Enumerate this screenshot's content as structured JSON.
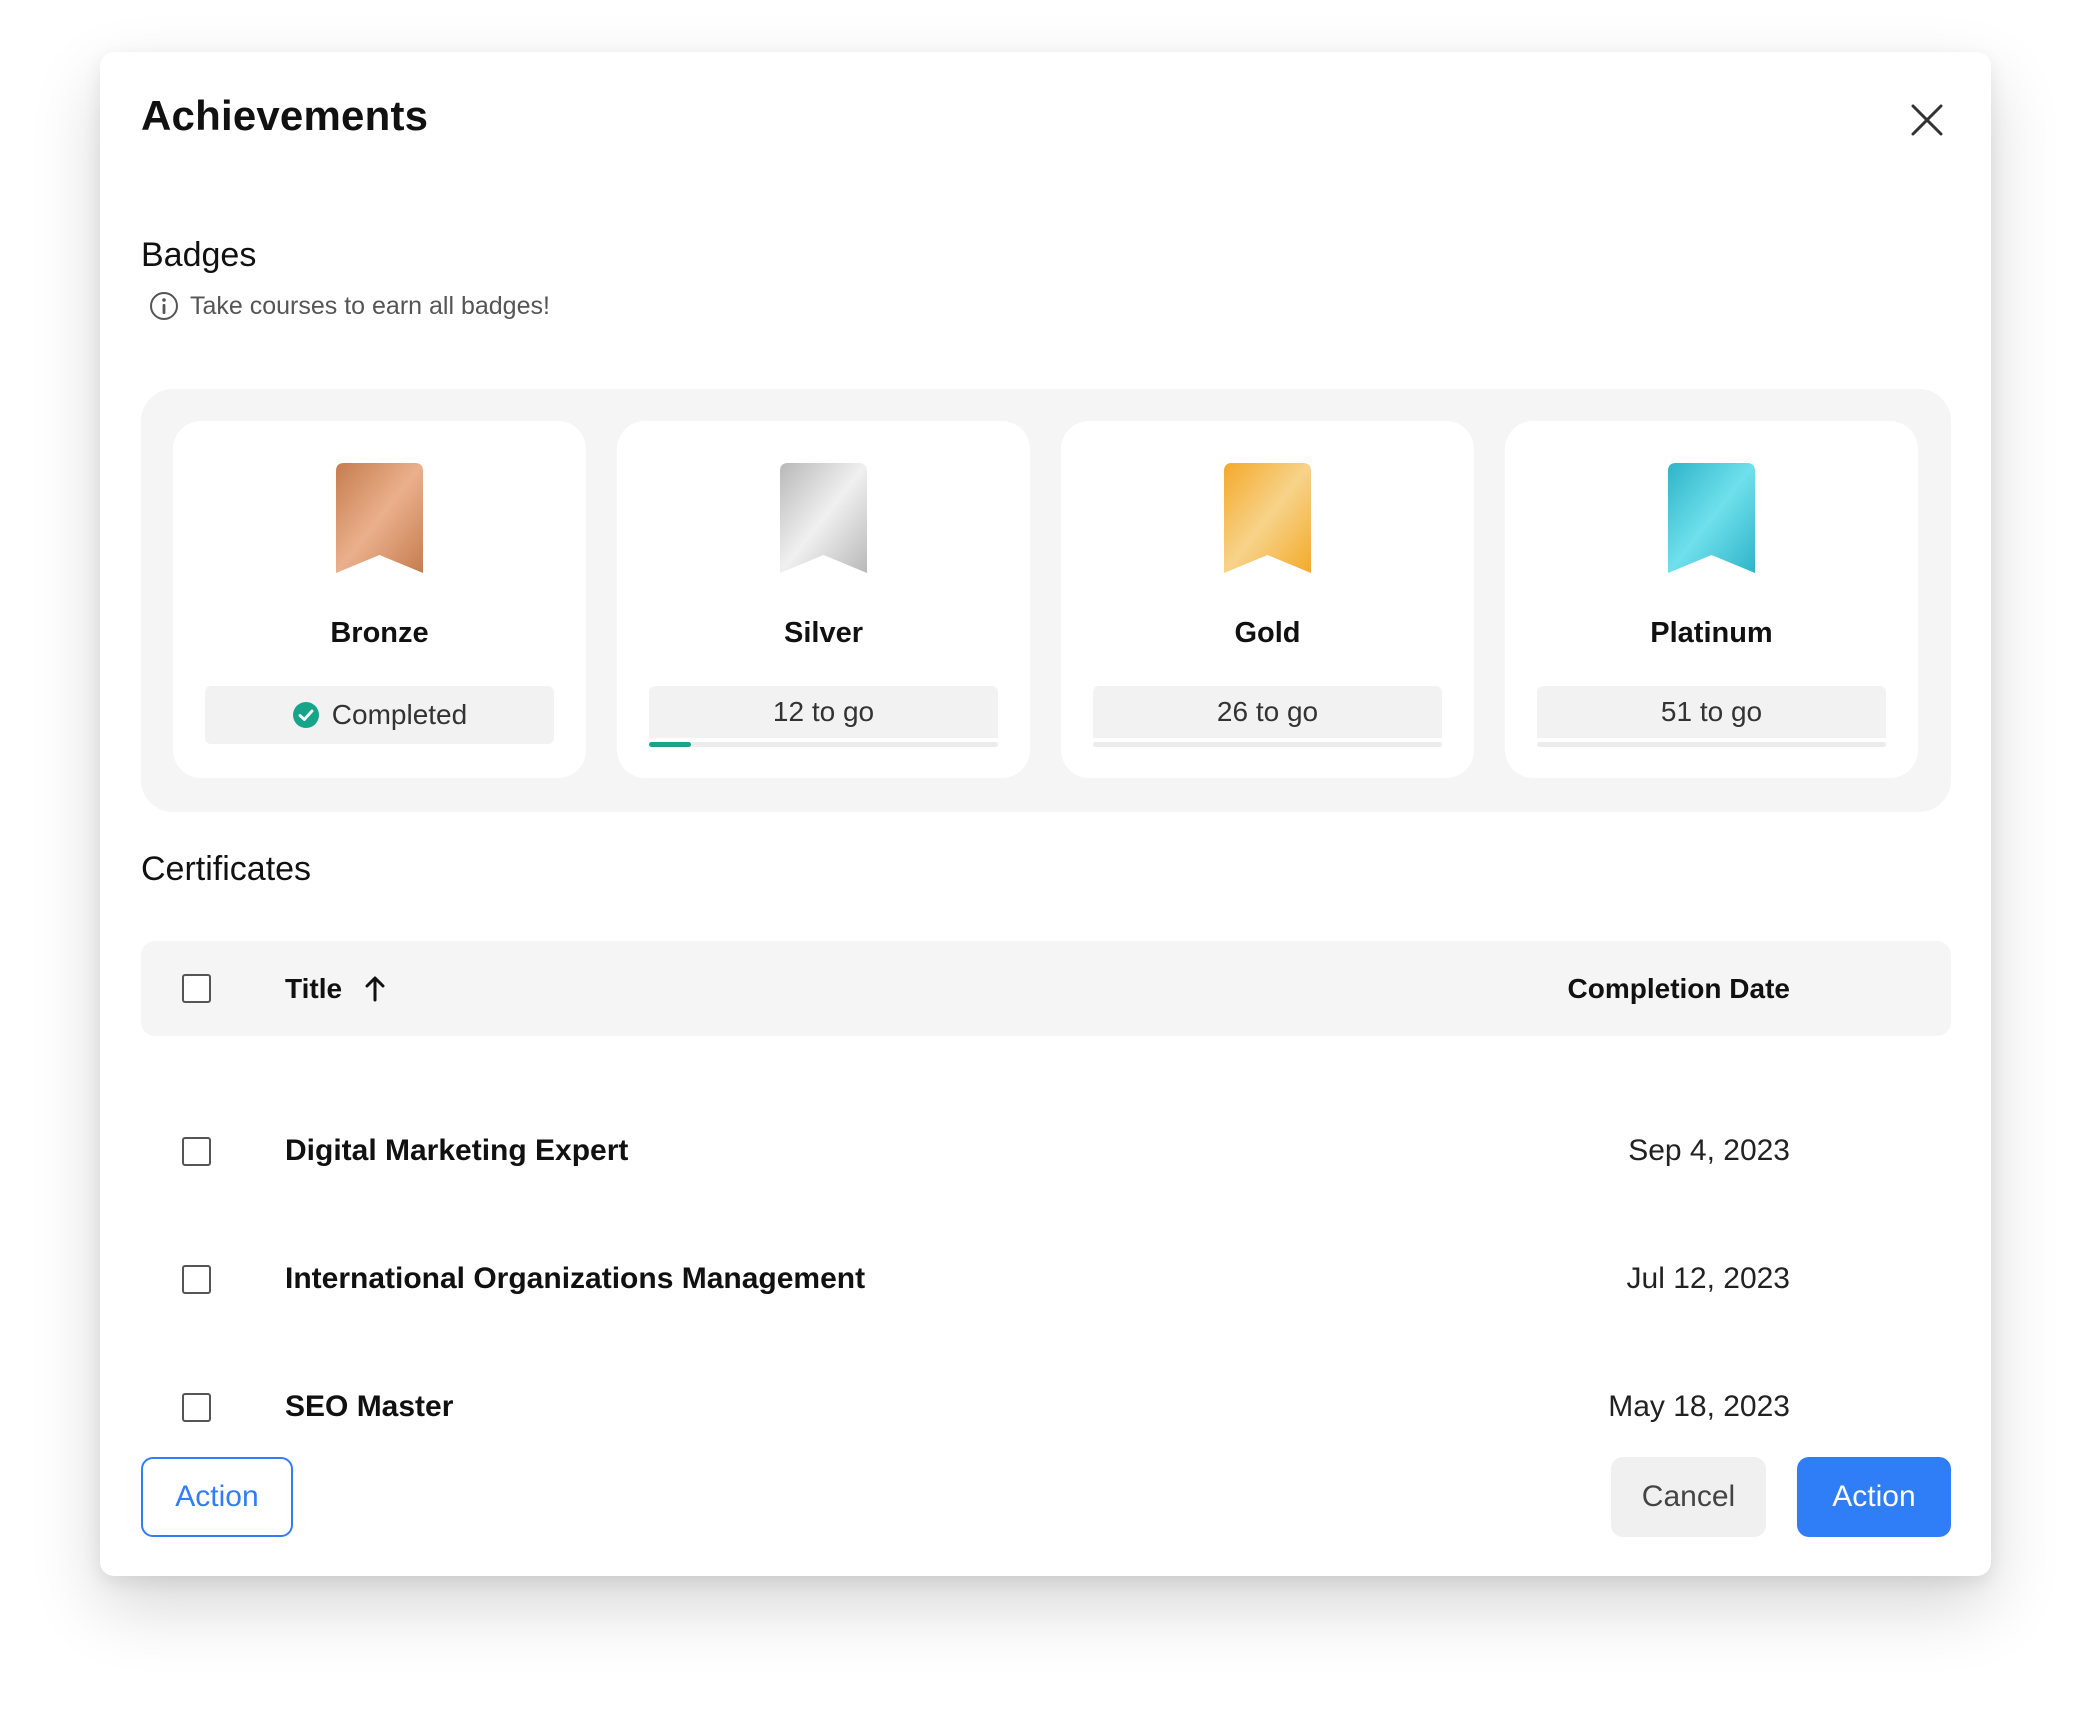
{
  "dialog": {
    "title": "Achievements",
    "close_icon": "close-icon"
  },
  "badges": {
    "heading": "Badges",
    "hint": "Take courses to earn all badges!",
    "items": [
      {
        "name": "Bronze",
        "status": "Completed",
        "completed": true,
        "progress": 1.0,
        "color_a": "#c67c4e",
        "color_b": "#eab08c"
      },
      {
        "name": "Silver",
        "status": "12 to go",
        "completed": false,
        "progress": 0.12,
        "color_a": "#b8b8b8",
        "color_b": "#f0f0f0"
      },
      {
        "name": "Gold",
        "status": "26 to go",
        "completed": false,
        "progress": 0.0,
        "color_a": "#f4a92a",
        "color_b": "#f7d38a"
      },
      {
        "name": "Platinum",
        "status": "51 to go",
        "completed": false,
        "progress": 0.0,
        "color_a": "#2eb4c8",
        "color_b": "#6fe0ec"
      }
    ],
    "progress_color": "#17a589"
  },
  "certificates": {
    "heading": "Certificates",
    "columns": {
      "title": "Title",
      "date": "Completion Date"
    },
    "sort": "ascending",
    "rows": [
      {
        "title": "Digital Marketing Expert",
        "date": "Sep 4, 2023"
      },
      {
        "title": "International Organizations Management",
        "date": "Jul 12, 2023"
      },
      {
        "title": "SEO Master",
        "date": "May 18, 2023"
      }
    ]
  },
  "footer": {
    "left_action": "Action",
    "cancel": "Cancel",
    "primary_action": "Action"
  },
  "colors": {
    "accent": "#2f7ef7",
    "success": "#17a589"
  }
}
